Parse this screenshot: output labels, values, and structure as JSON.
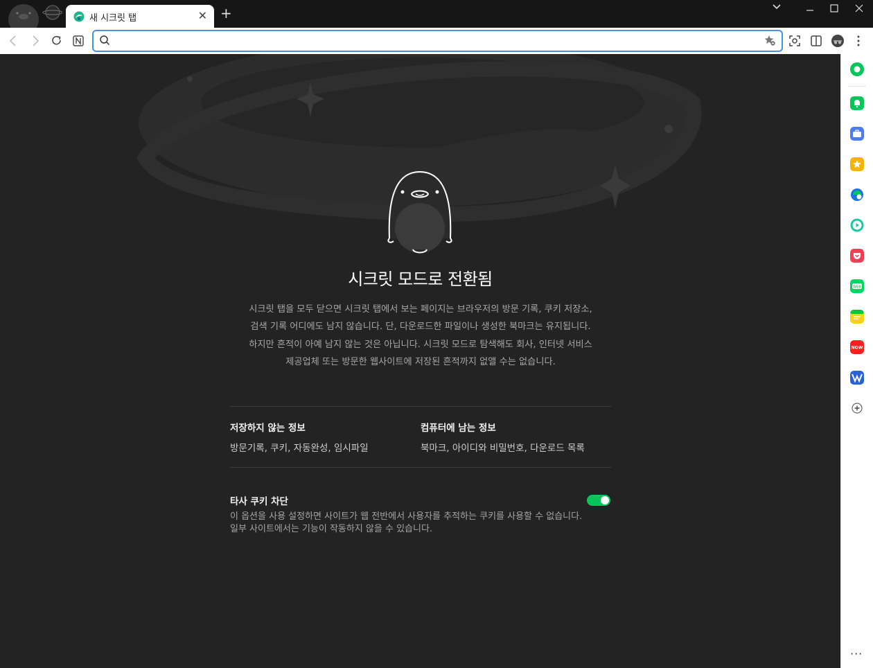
{
  "tab": {
    "title": "새 시크릿 탭",
    "close": "✕"
  },
  "toolbar": {
    "new_tab": "+",
    "address_value": "",
    "address_placeholder": ""
  },
  "window": {
    "minimize": "—",
    "maximize": "☐",
    "close": "✕",
    "tab_list": "⌄"
  },
  "main": {
    "title": "시크릿 모드로 전환됨",
    "description_lines": [
      "시크릿 탭을 모두 닫으면 시크릿 탭에서 보는 페이지는 브라우저의 방문 기록, 쿠키 저장소,",
      "검색 기록 어디에도 남지 않습니다. 단, 다운로드한 파일이나 생성한 북마크는 유지됩니다.",
      "하지만 흔적이 아예 남지 않는 것은 아닙니다. 시크릿 모드로 탐색해도 회사, 인터넷 서비스",
      "제공업체 또는 방문한 웹사이트에 저장된 흔적까지 없앨 수는 없습니다."
    ],
    "not_saved": {
      "heading": "저장하지 않는 정보",
      "value": "방문기록, 쿠키, 자동완성, 임시파일"
    },
    "saved": {
      "heading": "컴퓨터에 남는 정보",
      "value": "북마크, 아이디와 비밀번호, 다운로드 목록"
    },
    "third_party": {
      "heading": "타사 쿠키 차단",
      "desc_line1": "이 옵션을 사용 설정하면 사이트가 웹 전반에서 사용자를 추적하는 쿠키를 사용할 수 없습니다.",
      "desc_line2": "일부 사이트에서는 기능이 작동하지 않을 수 있습니다.",
      "enabled": true
    }
  },
  "sidebar": {
    "more": "···",
    "items": [
      {
        "icon": "green-circle-icon",
        "color": "#03c75a"
      },
      {
        "icon": "notification-icon",
        "color": "#03c75a"
      },
      {
        "icon": "briefcase-icon",
        "color": "#4d7cf2"
      },
      {
        "icon": "star-icon",
        "color": "#f5b400"
      },
      {
        "icon": "calendar-icon",
        "color": "#1a73e8"
      },
      {
        "icon": "play-icon",
        "color": "#19c7a0"
      },
      {
        "icon": "pocket-icon",
        "color": "#ef4056"
      },
      {
        "icon": "webtoon-icon",
        "color": "#00d564"
      },
      {
        "icon": "memo-icon",
        "color": "#f7d21b"
      },
      {
        "icon": "now-icon",
        "color": "#ff1e1e"
      },
      {
        "icon": "w-icon",
        "color": "#2a62d4"
      },
      {
        "icon": "add-icon",
        "color": "#555555"
      }
    ]
  },
  "colors": {
    "accent": "#03c75a",
    "focus": "#4a90d9",
    "background": "#232323"
  }
}
